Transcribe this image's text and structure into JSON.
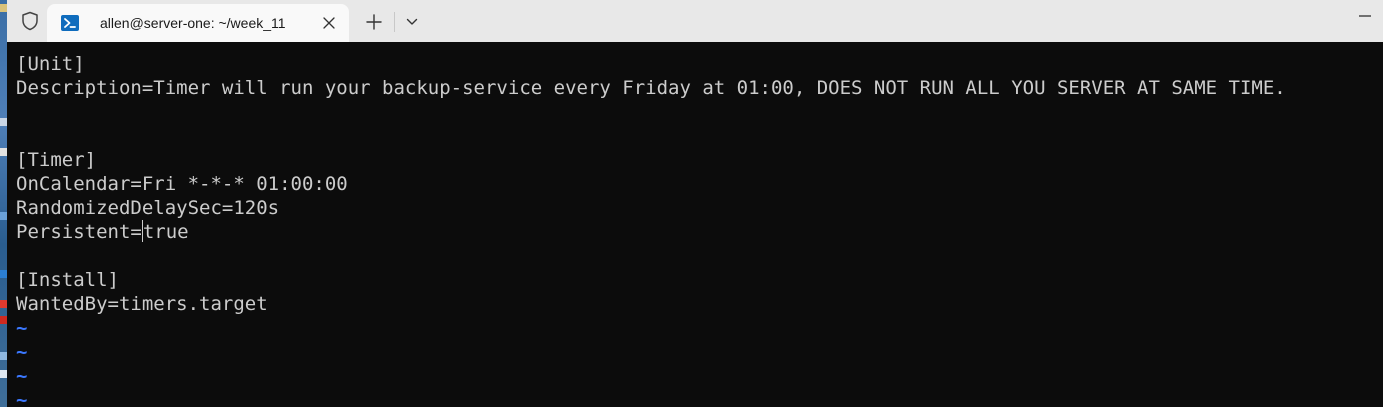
{
  "titlebar": {
    "tab_title": "allen@server-one: ~/week_11",
    "icons": {
      "shield": "shield-icon",
      "terminal": "powershell-terminal-icon",
      "close": "close-icon",
      "new_tab": "plus-icon",
      "dropdown": "chevron-down-icon",
      "minimize": "minimize-icon"
    }
  },
  "terminal": {
    "lines": [
      "[Unit]",
      "Description=Timer will run your backup-service every Friday at 01:00, DOES NOT RUN ALL YOU SERVER AT SAME TIME.",
      "",
      "",
      "[Timer]",
      "OnCalendar=Fri *-*-* 01:00:00",
      "RandomizedDelaySec=120s",
      "Persistent=",
      "",
      "[Install]",
      "WantedBy=timers.target"
    ],
    "cursor_after": "true",
    "empty_line_marker": "~"
  },
  "colors": {
    "titlebar_bg": "#e8e8e8",
    "tab_bg": "#f9f9f9",
    "terminal_bg": "#0c0c0c",
    "terminal_fg": "#cccccc",
    "tilde": "#3b78ff",
    "tab_icon_bg": "#0f6cbd"
  }
}
